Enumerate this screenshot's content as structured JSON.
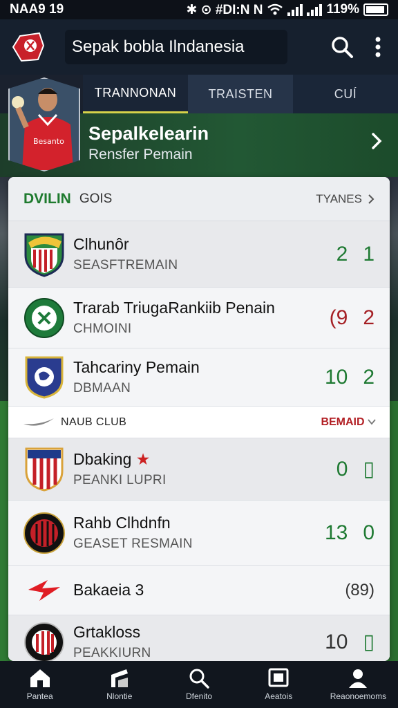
{
  "status_bar": {
    "time": "NAA9 19",
    "indicators": "✱ ⊙ #DI:N N",
    "battery_text": "119%"
  },
  "app_bar": {
    "title": "Sepak bobla Ilndanesia",
    "icons": [
      "club-logo-icon",
      "search-icon",
      "more-vert-icon"
    ]
  },
  "tabs": [
    {
      "label": "TRANNONAN",
      "active": true
    },
    {
      "label": "TRAISTEN",
      "active": false
    },
    {
      "label": "CUÍ",
      "active": false
    }
  ],
  "hero": {
    "title": "Sepalkelearin",
    "subtitle": "Rensfer Pemain",
    "jersey_text": "Besanto"
  },
  "list": {
    "header_label": "DVILIN",
    "header_sub": "GOIS",
    "header_right": "TYANES",
    "rows": [
      {
        "title": "Clhunôr",
        "subtitle": "SEASFTREMAIN",
        "score": [
          "2",
          "1"
        ],
        "colors": [
          "g",
          "g"
        ]
      },
      {
        "title": "Trarab TriugaRankiib Penain",
        "subtitle": "CHMOINI",
        "score": [
          "(9",
          "2"
        ],
        "colors": [
          "r",
          "r"
        ]
      },
      {
        "title": "Tahcariny Pemain",
        "subtitle": "DBMAAN",
        "score": [
          "10",
          "2"
        ],
        "colors": [
          "g",
          "g"
        ]
      },
      {
        "title": "Dbaking",
        "subtitle": "PEANKI LUPRI",
        "score": [
          "0",
          "▯"
        ],
        "colors": [
          "g",
          "g"
        ],
        "star": "★"
      },
      {
        "title": "Rahb Clhdnfn",
        "subtitle": "GEASET RESMAIN",
        "score": [
          "13",
          "0"
        ],
        "colors": [
          "g",
          "g"
        ]
      },
      {
        "title": "Bakaeia 3",
        "subtitle": "",
        "score": [
          "(89)"
        ],
        "colors": [
          "k"
        ]
      },
      {
        "title": "Grtakloss",
        "subtitle": "PEAKKIURN",
        "score": [
          "10",
          "▯"
        ],
        "colors": [
          "k",
          "g"
        ]
      }
    ],
    "divider": {
      "left": "NAUB CLUB",
      "right": "BEMAID"
    }
  },
  "bottom_nav": [
    {
      "label": "Pantea",
      "icon": "home-icon"
    },
    {
      "label": "Nlontie",
      "icon": "stadium-icon"
    },
    {
      "label": "Dfenito",
      "icon": "search-icon"
    },
    {
      "label": "Aeatois",
      "icon": "frame-icon"
    },
    {
      "label": "Reaonoemoms",
      "icon": "profile-icon"
    }
  ],
  "colors": {
    "accent_green": "#1f7a33",
    "accent_red": "#a52025",
    "tab_indicator": "#d6d24a"
  }
}
